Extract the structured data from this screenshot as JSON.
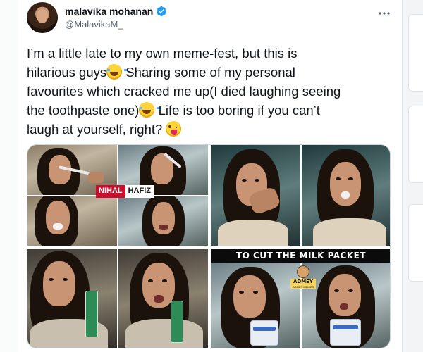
{
  "author": {
    "display_name": "malavika mohanan",
    "handle": "@MalavikaM_",
    "verified": true,
    "avatar_icon": "profile-photo"
  },
  "menu_icon": "more-horizontal-icon",
  "tweet": {
    "line1": "I’m a little late to my own meme-fest, but this is",
    "line2a": "hilarious guys",
    "line2b": " Sharing some of my personal",
    "line3": "favourites which cracked me up(I died laughing seeing",
    "line4a": "the toothpaste one)",
    "line4b": " Life is too boring if you can’t",
    "line5": "laugh at yourself, right? ",
    "emojis": [
      "face-with-tears-of-joy",
      "face-with-tears-of-joy",
      "zany-face"
    ]
  },
  "media": {
    "watermark_a": "NIHAL",
    "watermark_b": "HAFIZ",
    "caption_bottom_right": "TO CUT THE MILK PACKET",
    "logo_label": "ADMEY",
    "logo_sub": "ADMEY MEMES"
  },
  "colors": {
    "verified_blue": "#1d9bf0",
    "text_primary": "#0f1419",
    "text_secondary": "#536471"
  }
}
